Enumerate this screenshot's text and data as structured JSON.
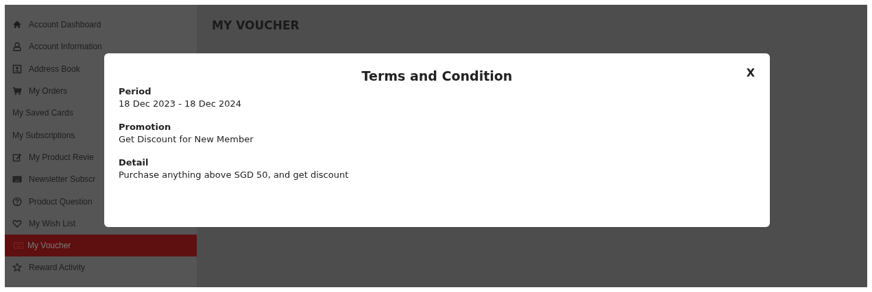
{
  "sidebar": {
    "items": [
      {
        "label": "Account Dashboard",
        "kind": "icon",
        "selected": false
      },
      {
        "label": "Account Information",
        "kind": "icon",
        "selected": false
      },
      {
        "label": "Address Book",
        "kind": "icon",
        "selected": false
      },
      {
        "label": "My Orders",
        "kind": "icon",
        "selected": false
      },
      {
        "label": "My Saved Cards",
        "kind": "plain",
        "selected": false
      },
      {
        "label": "My Subscriptions",
        "kind": "plain",
        "selected": false
      },
      {
        "label": "My Product Revie",
        "kind": "icon",
        "selected": false
      },
      {
        "label": "Newsletter Subscr",
        "kind": "icon",
        "selected": false
      },
      {
        "label": "Product Question",
        "kind": "icon",
        "selected": false
      },
      {
        "label": "My Wish List",
        "kind": "icon",
        "selected": false
      },
      {
        "label": "My Voucher",
        "kind": "icon",
        "selected": true
      },
      {
        "label": "Reward Activity",
        "kind": "icon",
        "selected": false
      }
    ]
  },
  "page": {
    "title": "MY VOUCHER"
  },
  "modal": {
    "title": "Terms and Condition",
    "close": "X",
    "sections": [
      {
        "heading": "Period",
        "text": "18 Dec 2023 - 18 Dec 2024"
      },
      {
        "heading": "Promotion",
        "text": "Get Discount for New Member"
      },
      {
        "heading": "Detail",
        "text": "Purchase anything above SGD 50, and get discount"
      }
    ]
  }
}
